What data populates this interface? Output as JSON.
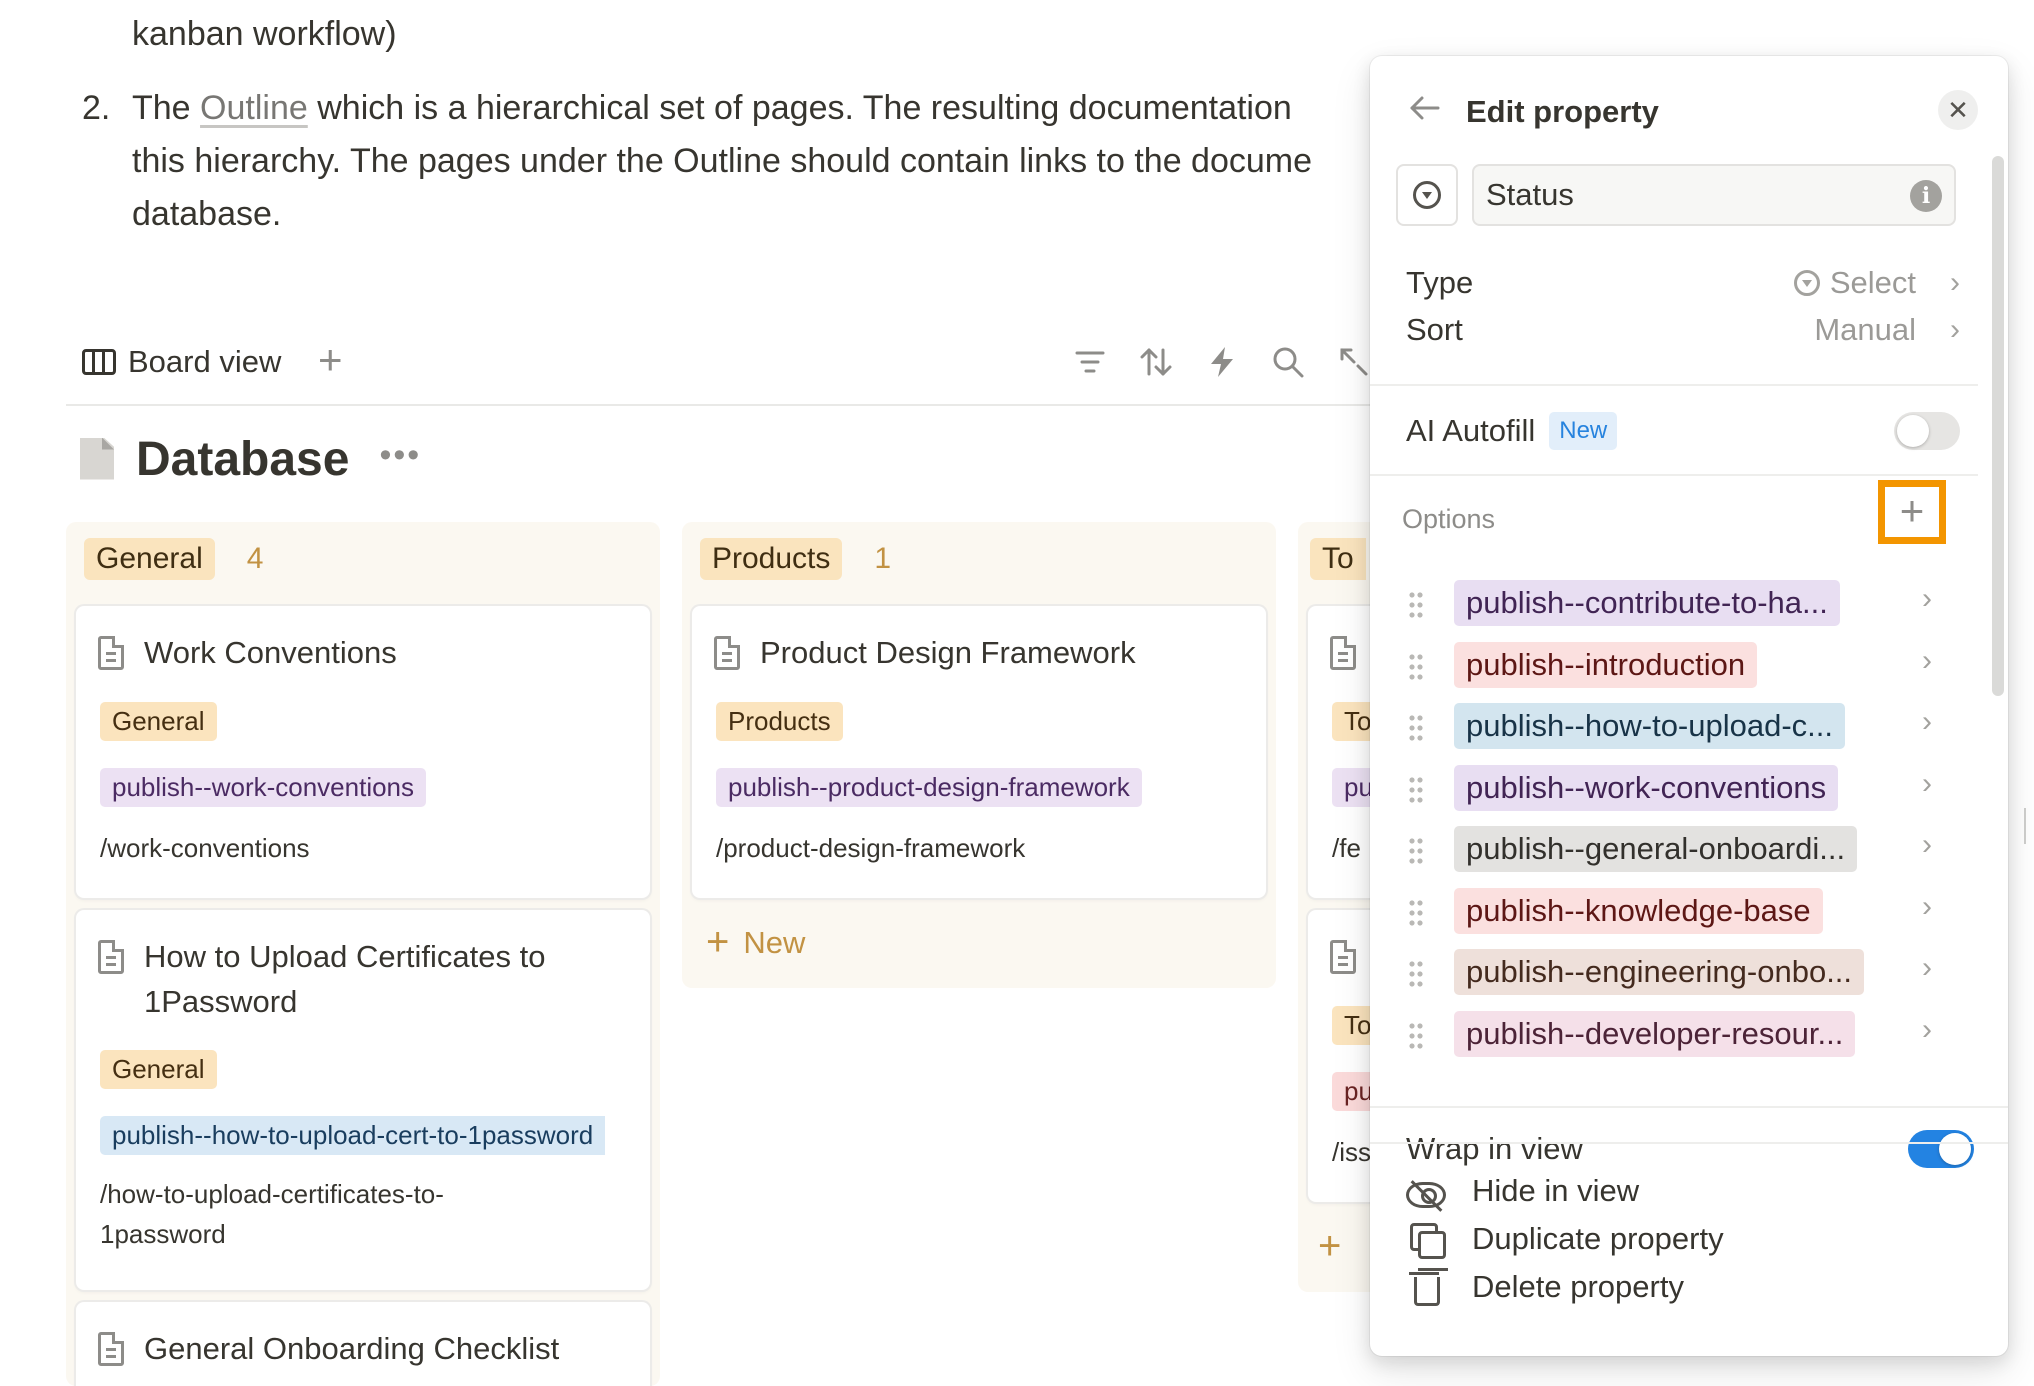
{
  "document": {
    "line1": "kanban workflow)",
    "item2_number": "2.",
    "item2_prefix": "The ",
    "item2_link": "Outline",
    "item2_rest": " which is a hierarchical set of pages. The resulting documentation",
    "item2_line2": "this hierarchy. The pages under the Outline should contain links to the docume",
    "item2_line3": "database."
  },
  "viewbar": {
    "view_label": "Board view",
    "add_view": "+",
    "tools": [
      "filter-icon",
      "sort-icon",
      "automation-icon",
      "search-icon",
      "expand-icon"
    ]
  },
  "database": {
    "title": "Database",
    "more": "•••"
  },
  "columns": {
    "general": {
      "label": "General",
      "count": "4",
      "cards": [
        {
          "title": "Work Conventions",
          "group_tag": "General",
          "status_tag": "publish--work-conventions",
          "url": "/work-conventions"
        },
        {
          "title": "How to Upload Certificates to 1Password",
          "group_tag": "General",
          "status_tag": "publish--how-to-upload-cert-to-1password",
          "url": "/how-to-upload-certificates-to-1password"
        },
        {
          "title": "General Onboarding Checklist"
        }
      ]
    },
    "products": {
      "label": "Products",
      "count": "1",
      "cards": [
        {
          "title": "Product Design Framework",
          "group_tag": "Products",
          "status_tag": "publish--product-design-framework",
          "url": "/product-design-framework"
        }
      ],
      "new_label": "New"
    },
    "todo": {
      "label": "To",
      "card1_tag": "To",
      "card1_status": "pu",
      "card1_url": "/fe",
      "card2_tag": "To",
      "card2_status": "pu",
      "card2_url": "/iss"
    }
  },
  "panel": {
    "title": "Edit property",
    "name_value": "Status",
    "info": "i",
    "type_label": "Type",
    "type_value": "Select",
    "sort_label": "Sort",
    "sort_value": "Manual",
    "ai_label": "AI Autofill",
    "ai_badge": "New",
    "ai_enabled": false,
    "options_label": "Options",
    "options_add": "+",
    "options": [
      {
        "label": "publish--contribute-to-ha...",
        "color": "purple"
      },
      {
        "label": "publish--introduction",
        "color": "red"
      },
      {
        "label": "publish--how-to-upload-c...",
        "color": "blue"
      },
      {
        "label": "publish--work-conventions",
        "color": "purple"
      },
      {
        "label": "publish--general-onboardi...",
        "color": "gray"
      },
      {
        "label": "publish--knowledge-base",
        "color": "red"
      },
      {
        "label": "publish--engineering-onbo...",
        "color": "brown"
      },
      {
        "label": "publish--developer-resour...",
        "color": "pink"
      }
    ],
    "wrap_label": "Wrap in view",
    "wrap_enabled": true,
    "actions": {
      "hide": "Hide in view",
      "duplicate": "Duplicate property",
      "delete": "Delete property"
    }
  }
}
